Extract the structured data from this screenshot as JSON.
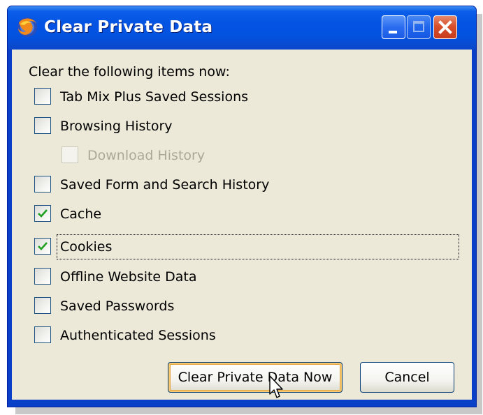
{
  "window": {
    "title": "Clear Private Data",
    "icon": "firefox-icon",
    "controls": [
      "minimize-icon",
      "maximize-icon",
      "close-icon"
    ]
  },
  "heading": "Clear the following items now:",
  "items": [
    {
      "label": "Tab Mix Plus Saved Sessions",
      "checked": false,
      "enabled": true
    },
    {
      "label": "Browsing History",
      "checked": false,
      "enabled": true
    },
    {
      "label": "Download History",
      "checked": false,
      "enabled": false
    },
    {
      "label": "Saved Form and Search History",
      "checked": false,
      "enabled": true
    },
    {
      "label": "Cache",
      "checked": true,
      "enabled": true
    },
    {
      "label": "Cookies",
      "checked": true,
      "enabled": true,
      "focused": true
    },
    {
      "label": "Offline Website Data",
      "checked": false,
      "enabled": true
    },
    {
      "label": "Saved Passwords",
      "checked": false,
      "enabled": true
    },
    {
      "label": "Authenticated Sessions",
      "checked": false,
      "enabled": true
    }
  ],
  "buttons": {
    "clear_now": "Clear Private Data Now",
    "cancel": "Cancel"
  },
  "colors": {
    "titlebar": "#0553e3",
    "dialog_bg": "#ece9d8",
    "check": "#21a121",
    "default_button_ring": "#f8c970"
  }
}
